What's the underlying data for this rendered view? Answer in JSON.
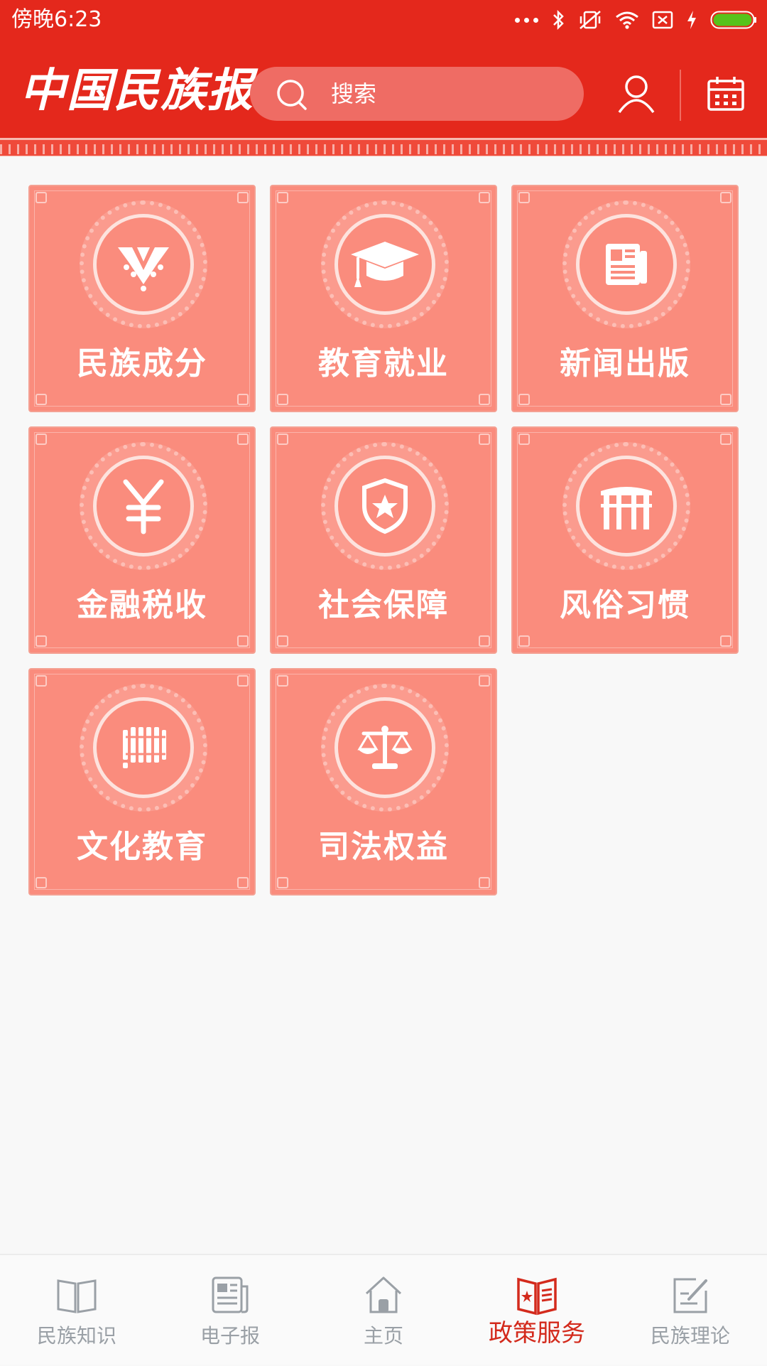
{
  "status_bar": {
    "time": "傍晚6:23",
    "icons": [
      "more-dots-icon",
      "bluetooth-icon",
      "vibrate-off-icon",
      "wifi-icon",
      "sim-icon",
      "charging-icon",
      "battery-icon"
    ]
  },
  "header": {
    "brand": "中国民族报",
    "search_placeholder": "搜索",
    "user_icon": "user-icon",
    "calendar_icon": "calendar-icon"
  },
  "colors": {
    "header_red": "#e4281c",
    "tile_salmon": "#fa8c7d",
    "active_red": "#d32a1c",
    "inactive_gray": "#9aa0a6"
  },
  "tiles": [
    {
      "label": "民族成分",
      "icon": "ethnic-costume-icon"
    },
    {
      "label": "教育就业",
      "icon": "graduation-cap-icon"
    },
    {
      "label": "新闻出版",
      "icon": "newspaper-icon"
    },
    {
      "label": "金融税收",
      "icon": "yen-icon"
    },
    {
      "label": "社会保障",
      "icon": "shield-star-icon"
    },
    {
      "label": "风俗习惯",
      "icon": "archway-icon"
    },
    {
      "label": "文化教育",
      "icon": "bamboo-scroll-icon"
    },
    {
      "label": "司法权益",
      "icon": "scales-icon"
    }
  ],
  "bottom_nav": [
    {
      "label": "民族知识",
      "icon": "open-book-icon",
      "active": false
    },
    {
      "label": "电子报",
      "icon": "epaper-icon",
      "active": false
    },
    {
      "label": "主页",
      "icon": "home-icon",
      "active": false
    },
    {
      "label": "政策服务",
      "icon": "policy-book-icon",
      "active": true
    },
    {
      "label": "民族理论",
      "icon": "edit-note-icon",
      "active": false
    }
  ]
}
